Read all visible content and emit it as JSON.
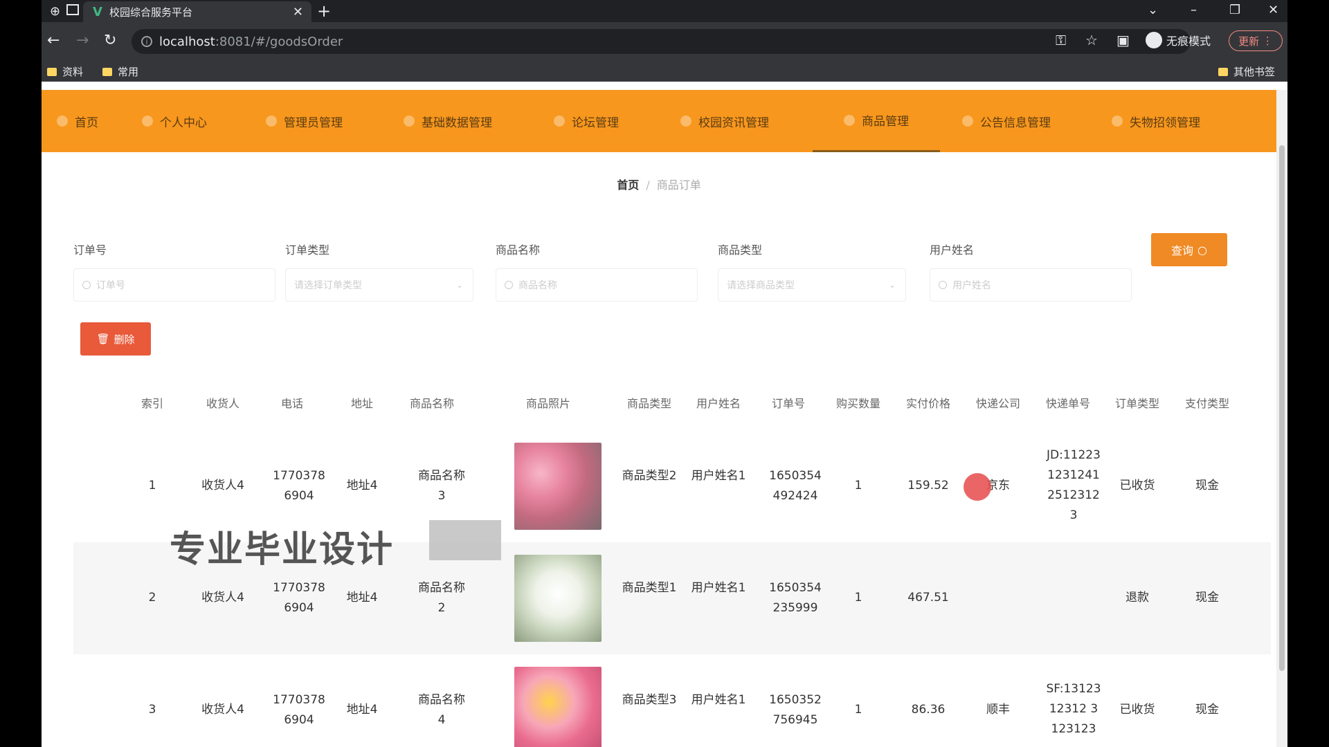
{
  "browser": {
    "tab_title": "校园综合服务平台",
    "url_host": "localhost",
    "url_path": ":8081/#/goodsOrder",
    "incognito_label": "无痕模式",
    "update_label": "更新",
    "bookmarks": [
      "资料",
      "常用"
    ],
    "other_bookmarks": "其他书签"
  },
  "nav": {
    "items": [
      {
        "label": "首页"
      },
      {
        "label": "个人中心"
      },
      {
        "label": "管理员管理"
      },
      {
        "label": "基础数据管理"
      },
      {
        "label": "论坛管理"
      },
      {
        "label": "校园资讯管理"
      },
      {
        "label": "商品管理"
      },
      {
        "label": "公告信息管理"
      },
      {
        "label": "失物招领管理"
      }
    ]
  },
  "breadcrumb": {
    "home": "首页",
    "separator": "/",
    "current": "商品订单"
  },
  "filters": {
    "order_no": {
      "label": "订单号",
      "placeholder": "订单号"
    },
    "order_type": {
      "label": "订单类型",
      "placeholder": "请选择订单类型"
    },
    "goods_name": {
      "label": "商品名称",
      "placeholder": "商品名称"
    },
    "goods_type": {
      "label": "商品类型",
      "placeholder": "请选择商品类型"
    },
    "user_name": {
      "label": "用户姓名",
      "placeholder": "用户姓名"
    },
    "query_label": "查询",
    "delete_label": "删除"
  },
  "table": {
    "headers": [
      "索引",
      "收货人",
      "电话",
      "地址",
      "商品名称",
      "商品照片",
      "商品类型",
      "用户姓名",
      "订单号",
      "购买数量",
      "实付价格",
      "快递公司",
      "快递单号",
      "订单类型",
      "支付类型"
    ],
    "rows": [
      {
        "index": "1",
        "receiver": "收货人4",
        "phone": "17703786904",
        "address": "地址4",
        "goods_name": "商品名称3",
        "goods_type": "商品类型2",
        "user_name": "用户姓名1",
        "order_no": "1650354492424",
        "qty": "1",
        "price": "159.52",
        "courier": "京东",
        "tracking": "JD:1122312312412512312 3",
        "order_type": "已收货",
        "pay_type": "现金"
      },
      {
        "index": "2",
        "receiver": "收货人4",
        "phone": "17703786904",
        "address": "地址4",
        "goods_name": "商品名称2",
        "goods_type": "商品类型1",
        "user_name": "用户姓名1",
        "order_no": "1650354235999",
        "qty": "1",
        "price": "467.51",
        "courier": "",
        "tracking": "",
        "order_type": "退款",
        "pay_type": "现金"
      },
      {
        "index": "3",
        "receiver": "收货人4",
        "phone": "17703786904",
        "address": "地址4",
        "goods_name": "商品名称4",
        "goods_type": "商品类型3",
        "user_name": "用户姓名1",
        "order_no": "1650352756945",
        "qty": "1",
        "price": "86.36",
        "courier": "顺丰",
        "tracking": "SF:1312312312 3123123",
        "order_type": "已收货",
        "pay_type": "现金"
      }
    ]
  },
  "watermark": "专业毕业设计"
}
